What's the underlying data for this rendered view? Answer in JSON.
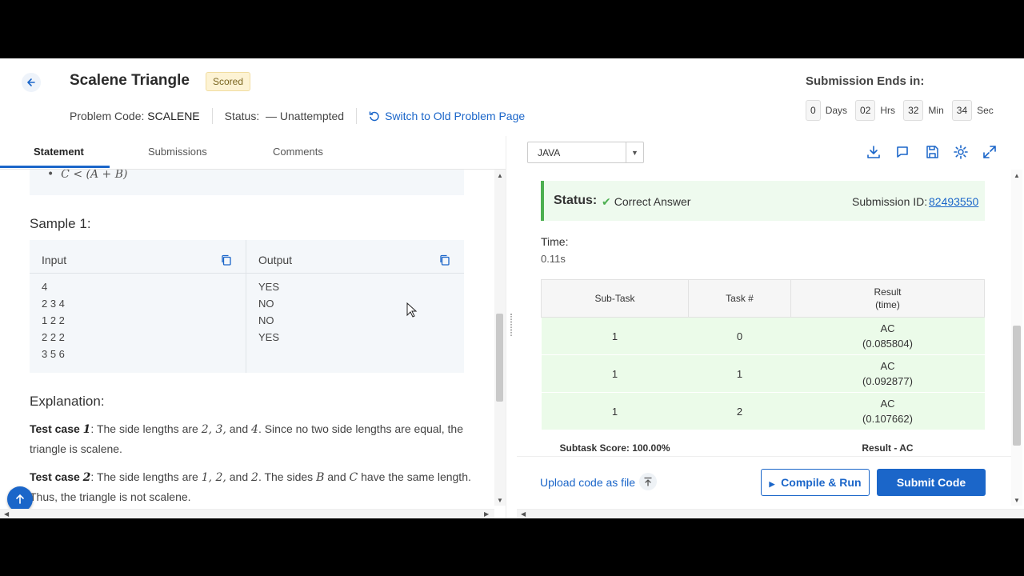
{
  "header": {
    "title": "Scalene Triangle",
    "badge": "Scored",
    "problem_code_label": "Problem Code:",
    "problem_code": "SCALENE",
    "status_label": "Status:",
    "status_value": "— Unattempted",
    "switch_link": "Switch to Old Problem Page",
    "submission_ends_label": "Submission Ends in:",
    "countdown": {
      "days": "0",
      "days_unit": "Days",
      "hours": "02",
      "hours_unit": "Hrs",
      "minutes": "32",
      "minutes_unit": "Min",
      "seconds": "34",
      "seconds_unit": "Sec"
    }
  },
  "tabs": {
    "statement": "Statement",
    "submissions": "Submissions",
    "comments": "Comments"
  },
  "statement": {
    "constraint_visible": "C < (A + B)",
    "sample_title": "Sample 1:",
    "input_header": "Input",
    "output_header": "Output",
    "input_text": "4\n2 3 4\n1 2 2\n2 2 2\n3 5 6",
    "output_text": "YES\nNO\nNO\nYES",
    "explanation_title": "Explanation:",
    "case1_label": "Test case",
    "case1_num": "1",
    "case1_text_a": ": The side lengths are ",
    "case1_vals": "2, 3,",
    "case1_text_b": " and ",
    "case1_last": "4",
    "case1_text_c": ". Since no two side lengths are equal, the triangle is scalene.",
    "case2_label": "Test case",
    "case2_num": "2",
    "case2_text_a": ": The side lengths are ",
    "case2_vals": "1, 2,",
    "case2_text_b": " and ",
    "case2_last": "2",
    "case2_text_c": ". The sides ",
    "case2_var_b": "B",
    "case2_and": " and ",
    "case2_var_c": "C",
    "case2_text_d": " have the same length. Thus, the triangle is not scalene."
  },
  "editor": {
    "language": "JAVA"
  },
  "result": {
    "status_label": "Status:",
    "status_value": "Correct Answer",
    "submission_id_label": "Submission ID:",
    "submission_id": "82493550",
    "time_label": "Time:",
    "time_value": "0.11s",
    "columns": {
      "subtask": "Sub-Task",
      "task": "Task #",
      "result": "Result",
      "result_sub": "(time)"
    },
    "rows": [
      {
        "subtask": "1",
        "task": "0",
        "result": "AC",
        "time": "(0.085804)"
      },
      {
        "subtask": "1",
        "task": "1",
        "result": "AC",
        "time": "(0.092877)"
      },
      {
        "subtask": "1",
        "task": "2",
        "result": "AC",
        "time": "(0.107662)"
      }
    ],
    "subtask_score": "Subtask Score: 100.00%",
    "result_summary": "Result - AC"
  },
  "actions": {
    "upload": "Upload code as file",
    "compile": "Compile & Run",
    "submit": "Submit Code"
  },
  "colors": {
    "accent": "#1b66c9",
    "success": "#4caf50",
    "success_bg": "#ebfbe9"
  }
}
